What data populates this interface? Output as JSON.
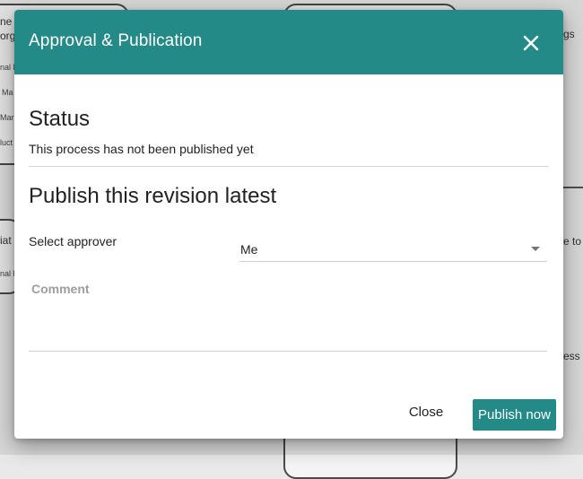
{
  "dialog": {
    "title": "Approval & Publication",
    "close_icon": "close-icon",
    "status": {
      "heading": "Status",
      "text": "This process has not been published yet"
    },
    "publish": {
      "heading": "Publish this revision latest",
      "approver_label": "Select approver",
      "approver_value": "Me",
      "comment_label": "Comment"
    },
    "buttons": {
      "close": "Close",
      "publish_now": "Publish now"
    }
  },
  "background": {
    "fragments": [
      "ne",
      "org",
      "nal F",
      "Ma",
      "Mar",
      "luct",
      "iat",
      "nal F",
      "gs",
      "e to",
      "ess"
    ]
  },
  "colors": {
    "accent": "#238a87",
    "header_text": "#ffffff"
  }
}
